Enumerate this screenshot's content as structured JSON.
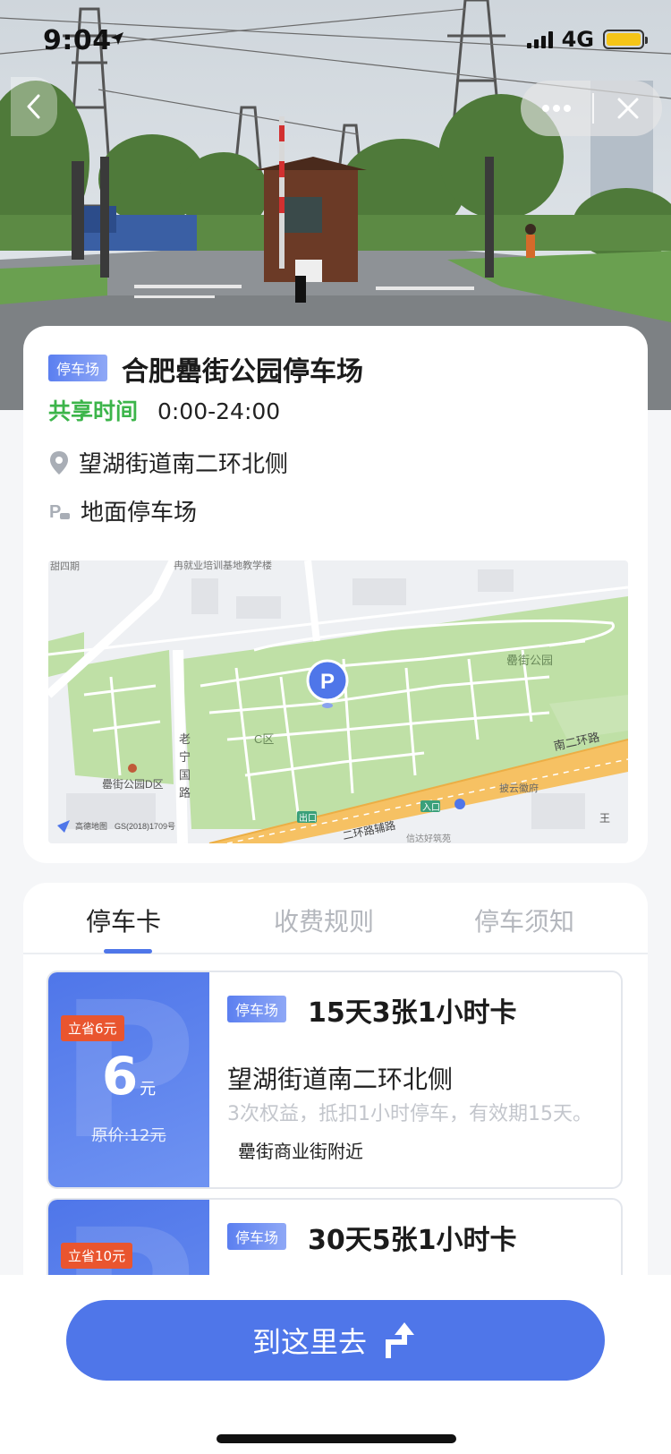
{
  "status_bar": {
    "time": "9:04",
    "network": "4G"
  },
  "info": {
    "tag": "停车场",
    "title": "合肥罍街公园停车场",
    "share_label": "共享时间",
    "share_time": "0:00-24:00",
    "address": "望湖街道南二环北侧",
    "lot_type": "地面停车场"
  },
  "map": {
    "labels": {
      "top_left": "甜四期",
      "top": "冉就业培训基地教学楼",
      "park": "罍街公园",
      "area_c": "C区",
      "area_d": "罍街公园D区",
      "road_v1": "老",
      "road_v2": "宁",
      "road_v3": "国",
      "road_v4": "路",
      "ring_road": "南二环路",
      "ring_aux": "二环路辅路",
      "exit": "出口",
      "entrance": "入口",
      "mall": "披云徽府",
      "bottom_cut": "信达好筑苑",
      "logo": "高德地图",
      "license": "GS(2018)1709号",
      "star": "王"
    },
    "pin": "P"
  },
  "tabs": [
    {
      "label": "停车卡",
      "active": true
    },
    {
      "label": "收费规则",
      "active": false
    },
    {
      "label": "停车须知",
      "active": false
    }
  ],
  "tickets": [
    {
      "save": "立省6元",
      "price": "6",
      "unit": "元",
      "original": "原价:12元",
      "tag": "停车场",
      "title": "15天3张1小时卡",
      "address": "望湖街道南二环北侧",
      "desc": "3次权益，抵扣1小时停车，有效期15天。",
      "near": "罍街商业街附近"
    },
    {
      "save": "立省10元",
      "tag": "停车场",
      "title": "30天5张1小时卡"
    }
  ],
  "nav_button": {
    "label": "到这里去"
  },
  "colors": {
    "accent": "#4f76e9",
    "share_green": "#3cb54a",
    "save_red": "#e9552f"
  }
}
